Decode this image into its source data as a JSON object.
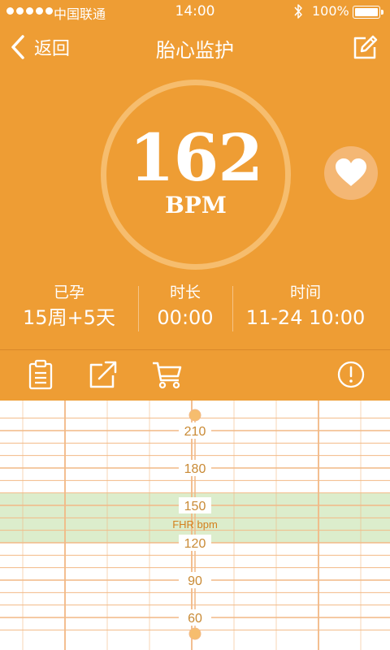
{
  "status_bar": {
    "carrier": "中国联通",
    "time": "14:00",
    "battery": "100%"
  },
  "nav": {
    "back_label": "返回",
    "title": "胎心监护"
  },
  "monitor": {
    "bpm": "162",
    "unit": "BPM"
  },
  "stats": {
    "pregnancy_label": "已孕",
    "pregnancy_value": "15周+5天",
    "duration_label": "时长",
    "duration_value": "00:00",
    "time_label": "时间",
    "time_value": "11-24 10:00"
  },
  "toolbar": {
    "icons": [
      "clipboard-icon",
      "share-icon",
      "cart-icon",
      "alert-icon"
    ]
  },
  "colors": {
    "primary": "#ee9d34",
    "ring": "#f6bd6e",
    "grid_line": "#f2b986",
    "normal_band": "#dcedcc"
  },
  "chart_data": {
    "type": "line",
    "title": "",
    "ylabel": "FHR bpm",
    "xlabel": "",
    "ylim": [
      60,
      210
    ],
    "yticks": [
      210,
      180,
      150,
      120,
      90,
      60
    ],
    "normal_range": [
      120,
      160
    ],
    "series": []
  }
}
